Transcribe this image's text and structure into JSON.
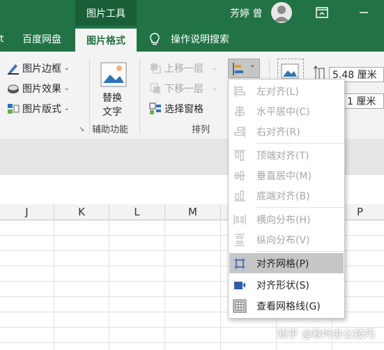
{
  "titlebar": {
    "context_tools": "图片工具",
    "user_name": "芳婷 曾"
  },
  "tabs": {
    "partial": "t",
    "baidu": "百度网盘",
    "active": "图片格式",
    "help": "操作说明搜索"
  },
  "ribbon": {
    "picture_border": "图片边框",
    "picture_effects": "图片效果",
    "picture_layout": "图片版式",
    "alt_text": "替换文字",
    "accessibility_group": "辅助功能",
    "bring_forward": "上移一层",
    "send_backward": "下移一层",
    "selection_pane": "选择窗格",
    "arrange_group": "排列",
    "height_value": "5.48 厘米",
    "width_value": "1 厘米"
  },
  "columns": [
    "J",
    "K",
    "L",
    "M",
    "N",
    "O",
    "P"
  ],
  "menu": {
    "align_left": "左对齐(L)",
    "align_center": "水平居中(C)",
    "align_right": "右对齐(R)",
    "align_top": "顶端对齐(T)",
    "align_middle": "垂直居中(M)",
    "align_bottom": "底端对齐(B)",
    "distribute_h": "横向分布(H)",
    "distribute_v": "纵向分布(V)",
    "snap_grid": "对齐网格(P)",
    "snap_shape": "对齐形状(S)",
    "view_gridlines": "查看网格线(G)"
  },
  "watermark": "知乎 @秋叶办公技巧",
  "colors": {
    "accent": "#217346",
    "accent_dark": "#1a5e38",
    "highlight": "#c6c6c6",
    "disabled": "#a6a6a6"
  }
}
